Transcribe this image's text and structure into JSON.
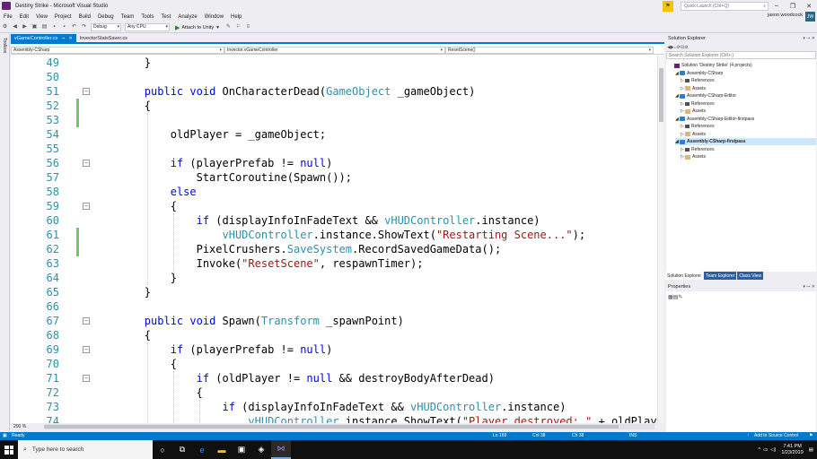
{
  "window": {
    "title": "Destiny Strike - Microsoft Visual Studio"
  },
  "quick_launch": {
    "placeholder": "Quick Launch (Ctrl+Q)"
  },
  "user": {
    "name": "jason woodcock",
    "initials": "JW"
  },
  "menu": [
    "File",
    "Edit",
    "View",
    "Project",
    "Build",
    "Debug",
    "Team",
    "Tools",
    "Test",
    "Analyze",
    "Window",
    "Help"
  ],
  "toolbar": {
    "config": "Debug",
    "platform": "Any CPU",
    "attach": "Attach to Unity"
  },
  "left_strip": {
    "label": "Toolbox"
  },
  "tabs": [
    {
      "label": "vGameController.cs",
      "active": true
    },
    {
      "label": "InvectorStatsSaver.cs",
      "active": false
    }
  ],
  "navbar": {
    "project": "Assembly-CSharp",
    "class": "Invector.vGameController",
    "member": "ResetScene()"
  },
  "code": {
    "lines": [
      {
        "n": "49",
        "text": "        }"
      },
      {
        "n": "50",
        "text": ""
      },
      {
        "n": "51",
        "text": "        public void OnCharacterDead(GameObject _gameObject)",
        "fold": true
      },
      {
        "n": "52",
        "text": "        {",
        "changed": true
      },
      {
        "n": "53",
        "text": "",
        "changed": true
      },
      {
        "n": "54",
        "text": "            oldPlayer = _gameObject;"
      },
      {
        "n": "55",
        "text": ""
      },
      {
        "n": "56",
        "text": "            if (playerPrefab != null)",
        "fold": true
      },
      {
        "n": "57",
        "text": "                StartCoroutine(Spawn());"
      },
      {
        "n": "58",
        "text": "            else"
      },
      {
        "n": "59",
        "text": "            {",
        "fold": true
      },
      {
        "n": "60",
        "text": "                if (displayInfoInFadeText && vHUDController.instance)"
      },
      {
        "n": "61",
        "text": "                    vHUDController.instance.ShowText(\"Restarting Scene...\");",
        "changed": true
      },
      {
        "n": "62",
        "text": "                PixelCrushers.SaveSystem.RecordSavedGameData();",
        "changed": true
      },
      {
        "n": "63",
        "text": "                Invoke(\"ResetScene\", respawnTimer);"
      },
      {
        "n": "64",
        "text": "            }"
      },
      {
        "n": "65",
        "text": "        }"
      },
      {
        "n": "66",
        "text": ""
      },
      {
        "n": "67",
        "text": "        public void Spawn(Transform _spawnPoint)",
        "fold": true
      },
      {
        "n": "68",
        "text": "        {"
      },
      {
        "n": "69",
        "text": "            if (playerPrefab != null)",
        "fold": true
      },
      {
        "n": "70",
        "text": "            {"
      },
      {
        "n": "71",
        "text": "                if (oldPlayer != null && destroyBodyAfterDead)",
        "fold": true
      },
      {
        "n": "72",
        "text": "                {"
      },
      {
        "n": "73",
        "text": "                    if (displayInfoInFadeText && vHUDController.instance)"
      },
      {
        "n": "74",
        "text": "                        vHUDController.instance.ShowText(\"Player destroyed: \" + oldPlayer.name"
      }
    ]
  },
  "zoom": "200 %",
  "solution_explorer": {
    "title": "Solution Explorer",
    "search_placeholder": "Search Solution Explorer (Ctrl+;)",
    "items": [
      {
        "label": "Solution 'Destiny Strike' (4 projects)",
        "icon": "solution-icon",
        "level": 0
      },
      {
        "label": "Assembly-CSharp",
        "icon": "csharp-project-icon",
        "level": 1
      },
      {
        "label": "References",
        "icon": "references-icon",
        "level": 2
      },
      {
        "label": "Assets",
        "icon": "folder-icon",
        "level": 2
      },
      {
        "label": "Assembly-CSharp-Editor",
        "icon": "csharp-project-icon",
        "level": 1
      },
      {
        "label": "References",
        "icon": "references-icon",
        "level": 2
      },
      {
        "label": "Assets",
        "icon": "folder-icon",
        "level": 2
      },
      {
        "label": "Assembly-CSharp-Editor-firstpass",
        "icon": "csharp-project-icon",
        "level": 1
      },
      {
        "label": "References",
        "icon": "references-icon",
        "level": 2
      },
      {
        "label": "Assets",
        "icon": "folder-icon",
        "level": 2
      },
      {
        "label": "Assembly-CSharp-firstpass",
        "icon": "csharp-project-icon",
        "level": 1,
        "selected": true
      },
      {
        "label": "References",
        "icon": "references-icon",
        "level": 2
      },
      {
        "label": "Assets",
        "icon": "folder-icon",
        "level": 2
      }
    ],
    "tabs": [
      "Solution Explorer",
      "Team Explorer",
      "Class View"
    ]
  },
  "properties": {
    "title": "Properties"
  },
  "status": {
    "ready": "Ready",
    "ln": "Ln 169",
    "col": "Col 38",
    "ch": "Ch 38",
    "mode": "INS",
    "source_control": "Add to Source Control"
  },
  "taskbar": {
    "search": "Type here to search",
    "time": "7:41 PM",
    "date": "1/23/2019"
  },
  "colors": {
    "accent": "#007acc",
    "keyword": "#0000ff",
    "type": "#2b91af",
    "string": "#a31515",
    "changed": "#6ec86e"
  }
}
